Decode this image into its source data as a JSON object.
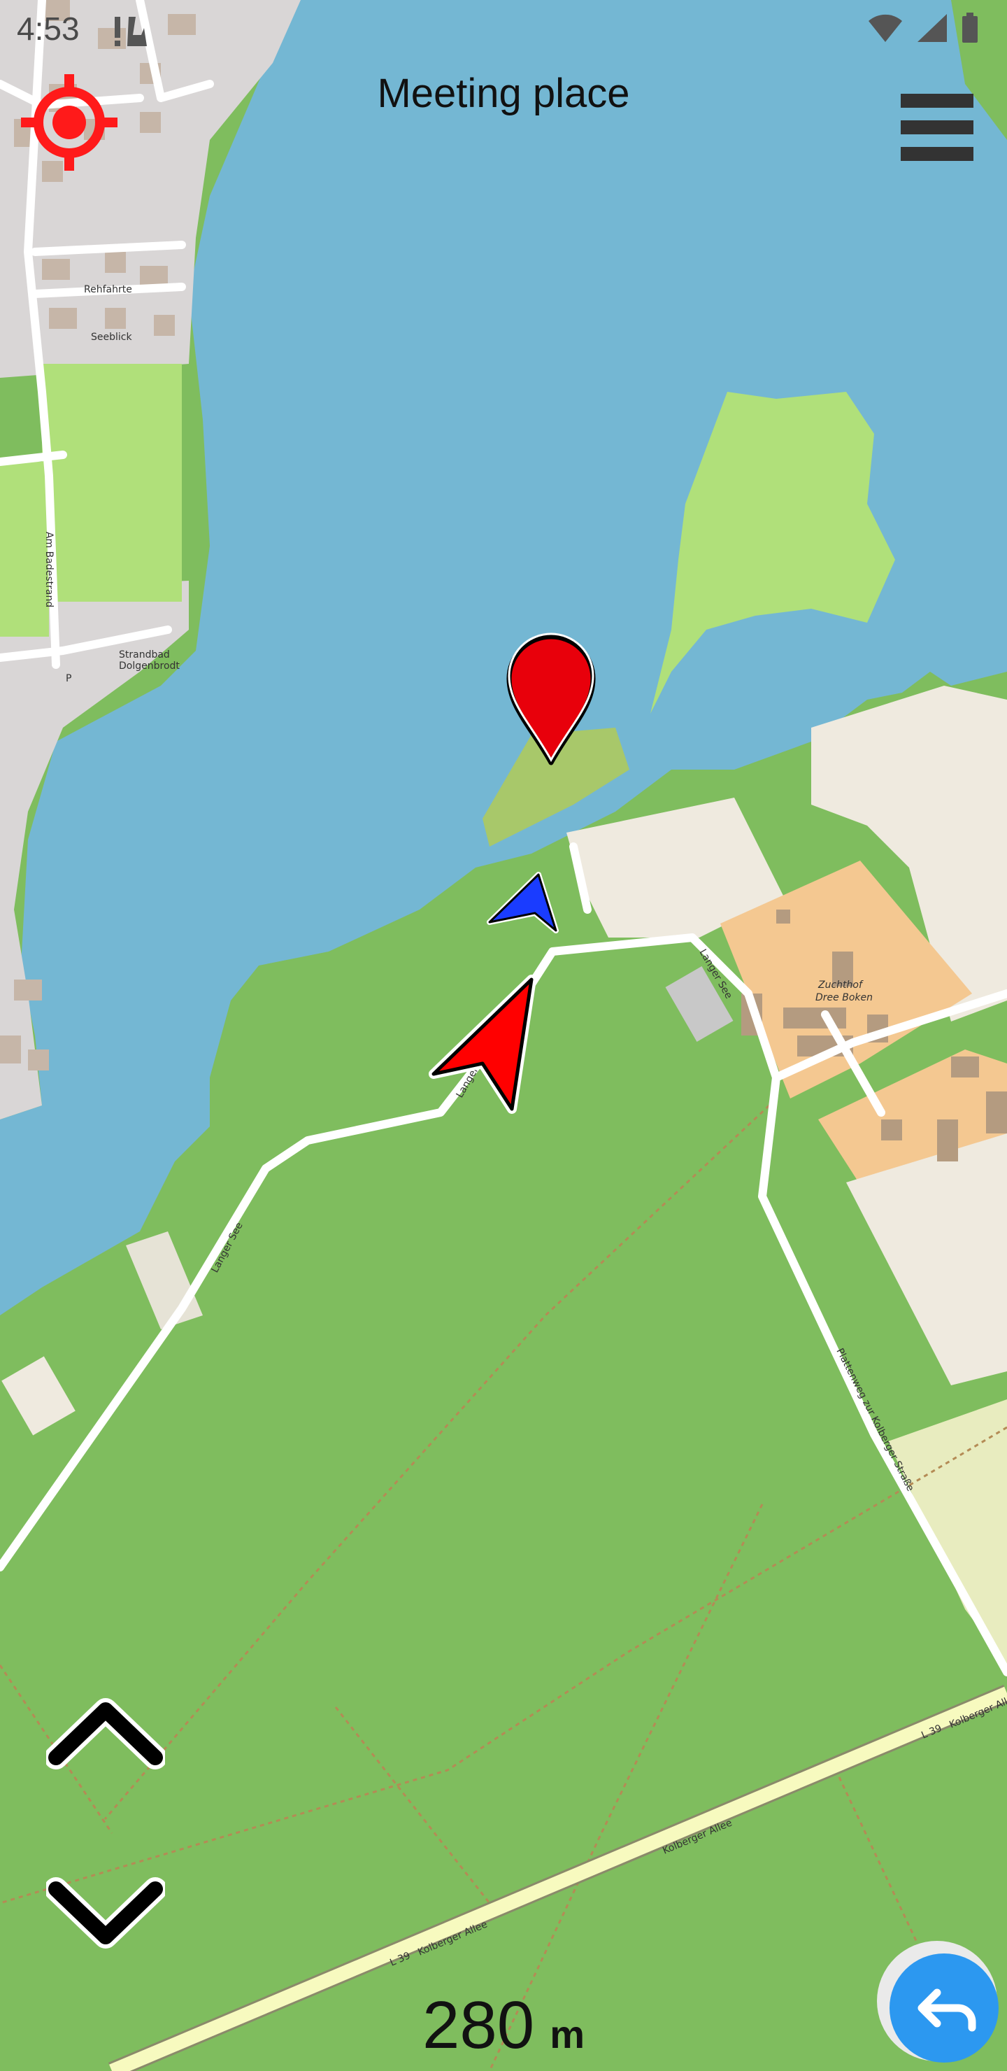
{
  "status": {
    "time": "4:53"
  },
  "header": {
    "title": "Meeting place"
  },
  "footer": {
    "distance_value": "280",
    "distance_unit": "m"
  },
  "map_labels": {
    "rehfahrte": "Rehfahrte",
    "seeblick": "Seeblick",
    "am_badestrand": "Am Badestrand",
    "strandbad": "Strandbad",
    "dolgenbrodt": "Dolgenbrodt",
    "zuchthof": "Zuchthof",
    "dree_boken": "Dree Boken",
    "langer_see_1": "Langer See",
    "langer_see_2": "Langer See",
    "langer_see_3": "Langer See",
    "l39": "L 39",
    "kolberger_allee_1": "Kolberger Allee",
    "kolberger_allee_2": "Kolberger Allee",
    "l39_2": "L 39",
    "kolberger_allee_3": "Kolberger Allee",
    "plattenweg": "Plattenweg zur Kolberger Straße",
    "p_symbol": "P"
  },
  "colors": {
    "water": "#74b7d3",
    "forest": "#7fbd5e",
    "meadow": "#b0e07a",
    "urban": "#d9d6d6",
    "farmyard": "#f4c891",
    "farmland": "#efeadf",
    "accent_red": "#ff1a1a",
    "fab_blue": "#2c98f0"
  }
}
